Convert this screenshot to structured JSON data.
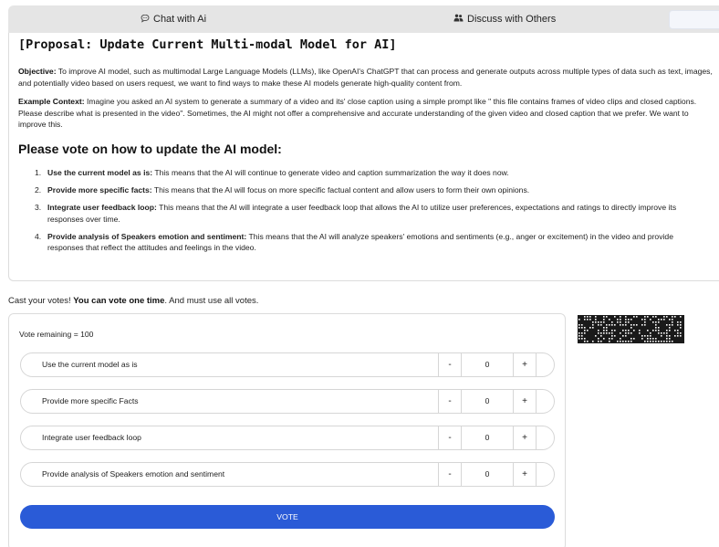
{
  "tabs": {
    "chat_label": "Chat with Ai",
    "discuss_label": "Discuss with Others"
  },
  "proposal": {
    "title": "[Proposal: Update Current Multi-modal Model for AI]",
    "objective_label": "Objective:",
    "objective_text": "To improve AI model, such as multimodal Large Language Models (LLMs), like OpenAI's ChatGPT that can process and generate outputs across multiple types of data such as text, images, and potentially video based on users request, we want to find ways to make these AI models generate high-quality content from.",
    "context_label": "Example Context:",
    "context_text": "Imagine you asked an AI system to generate a summary of a video and its' close caption using a simple prompt like \" this file contains frames of video clips and closed captions. Please describe what is presented in the video\". Sometimes, the AI might not offer a comprehensive and accurate understanding of the given video and closed caption that we prefer. We want to improve this.",
    "vote_heading": "Please vote on how to update the AI model:",
    "options": [
      {
        "num": "1.",
        "label": "Use the current model as is:",
        "text": "This means that the AI will continue to generate video and caption summarization the way it does now."
      },
      {
        "num": "2.",
        "label": "Provide more specific facts:",
        "text": "This means that the AI will focus on more specific factual content and allow users to form their own opinions."
      },
      {
        "num": "3.",
        "label": "Integrate user feedback loop:",
        "text": "This means that the AI will integrate a user feedback loop that allows the AI to utilize user preferences, expectations and ratings to directly improve its responses over time."
      },
      {
        "num": "4.",
        "label": "Provide analysis of Speakers emotion and sentiment:",
        "text": "This means that the AI will analyze speakers' emotions and sentiments (e.g., anger or excitement) in the video and provide responses that reflect the attitudes and feelings in the video."
      }
    ]
  },
  "cast": {
    "prefix": "Cast your votes!",
    "bold": "You can vote one time",
    "suffix": ". And must use all votes."
  },
  "voting": {
    "remaining_text": "Vote remaining = 100",
    "rows": [
      {
        "label": "Use the current model as is",
        "minus": "-",
        "value": "0",
        "plus": "+"
      },
      {
        "label": "Provide more specific Facts",
        "minus": "-",
        "value": "0",
        "plus": "+"
      },
      {
        "label": "Integrate user feedback loop",
        "minus": "-",
        "value": "0",
        "plus": "+"
      },
      {
        "label": "Provide analysis of Speakers emotion and sentiment",
        "minus": "-",
        "value": "0",
        "plus": "+"
      }
    ],
    "vote_button": "VOTE"
  },
  "colors": {
    "accent": "#2a5bd7",
    "tabbar": "#e5e5e5"
  },
  "icons": {
    "chat": "speech-bubble-icon",
    "discuss": "people-icon"
  }
}
